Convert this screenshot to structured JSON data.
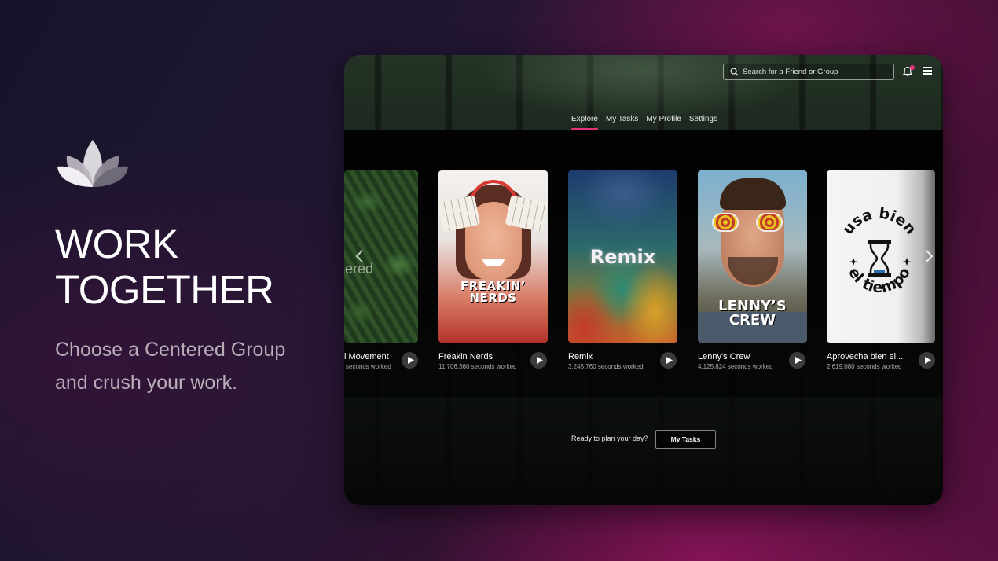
{
  "hero": {
    "title_line1": "WORK",
    "title_line2": "TOGETHER",
    "subtitle_line1": "Choose a Centered Group",
    "subtitle_line2": "and crush your work."
  },
  "app": {
    "search": {
      "placeholder": "Search for a Friend or Group",
      "icon": "search-icon"
    },
    "header_icons": [
      "bell-icon",
      "menu-icon"
    ],
    "accent_color": "#e8307a",
    "tabs": [
      {
        "label": "Explore",
        "active": true
      },
      {
        "label": "My Tasks",
        "active": false
      },
      {
        "label": "My Profile",
        "active": false
      },
      {
        "label": "Settings",
        "active": false
      }
    ],
    "groups": [
      {
        "title": "l Movement",
        "stats": "seconds worked",
        "cover_text": "ntered"
      },
      {
        "title": "Freakin Nerds",
        "stats": "11,706,360 seconds worked",
        "cover_text_1": "FREAKIN’",
        "cover_text_2": "NERDS"
      },
      {
        "title": "Remix",
        "stats": "3,245,760 seconds worked",
        "cover_text": "Remix"
      },
      {
        "title": "Lenny's Crew",
        "stats": "4,125,824 seconds worked",
        "cover_text_1": "LENNY’S",
        "cover_text_2": "CREW"
      },
      {
        "title": "Aprovecha bien el...",
        "stats": "2,619,080 seconds worked",
        "cover_text_1": "usa bien",
        "cover_text_2": "el tiempo"
      }
    ],
    "cta": {
      "prompt": "Ready to plan your day?",
      "button_label": "My Tasks"
    }
  }
}
